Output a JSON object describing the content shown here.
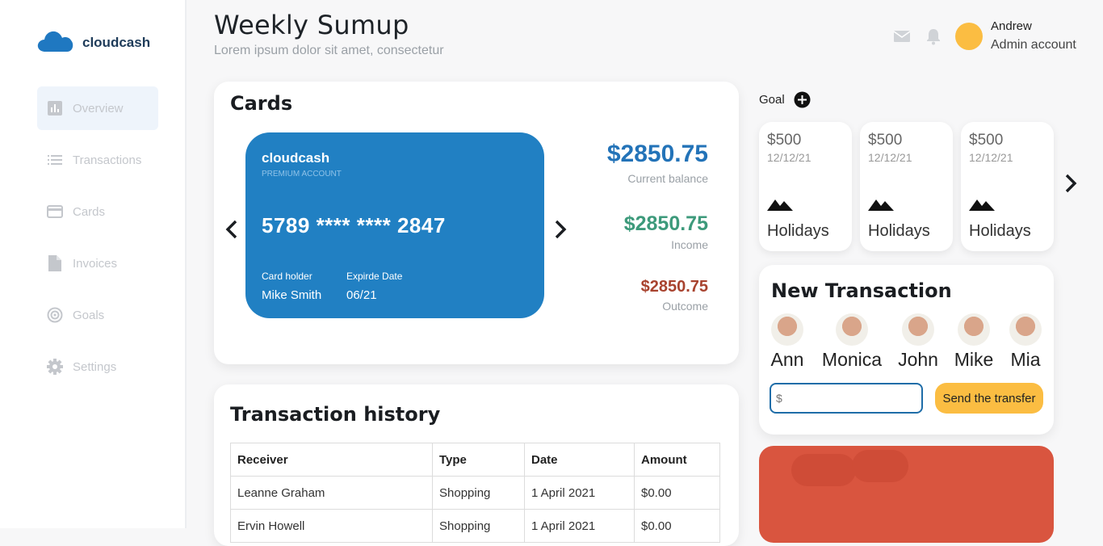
{
  "brand": {
    "name": "cloudcash",
    "color": "#1f78c1"
  },
  "sidebar": {
    "items": [
      {
        "label": "Overview",
        "icon": "bar-chart-icon",
        "active": true
      },
      {
        "label": "Transactions",
        "icon": "list-icon"
      },
      {
        "label": "Cards",
        "icon": "credit-card-icon"
      },
      {
        "label": "Invoices",
        "icon": "document-icon"
      },
      {
        "label": "Goals",
        "icon": "target-icon"
      },
      {
        "label": "Settings",
        "icon": "gear-icon"
      }
    ]
  },
  "header": {
    "title": "Weekly Sumup",
    "subtitle": "Lorem ipsum dolor sit amet, consectetur",
    "user": {
      "name": "Andrew",
      "role": "Admin account"
    }
  },
  "cards": {
    "title": "Cards",
    "card": {
      "brand": "cloudcash",
      "tier": "PREMIUM ACCOUNT",
      "number": "5789 **** **** 2847",
      "holder_label": "Card holder",
      "holder": "Mike Smith",
      "expiry_label": "Expirde Date",
      "expiry": "06/21",
      "color": "#2180c3"
    },
    "balances": [
      {
        "amount": "$2850.75",
        "label": "Current balance",
        "color": "#2373b8"
      },
      {
        "amount": "$2850.75",
        "label": "Income",
        "color": "#3d9a7b"
      },
      {
        "amount": "$2850.75",
        "label": "Outcome",
        "color": "#a8432f"
      }
    ]
  },
  "history": {
    "title": "Transaction history",
    "columns": [
      "Receiver",
      "Type",
      "Date",
      "Amount"
    ],
    "rows": [
      [
        "Leanne Graham",
        "Shopping",
        "1 April 2021",
        "$0.00"
      ],
      [
        "Ervin Howell",
        "Shopping",
        "1 April 2021",
        "$0.00"
      ]
    ]
  },
  "goals": {
    "label": "Goal",
    "items": [
      {
        "amount": "$500",
        "date": "12/12/21",
        "name": "Holidays"
      },
      {
        "amount": "$500",
        "date": "12/12/21",
        "name": "Holidays"
      },
      {
        "amount": "$500",
        "date": "12/12/21",
        "name": "Holidays"
      }
    ]
  },
  "new_transaction": {
    "title": "New Transaction",
    "people": [
      "Ann",
      "Monica",
      "John",
      "Mike",
      "Mia"
    ],
    "amount_placeholder": "$",
    "send_label": "Send the transfer"
  },
  "colors": {
    "accent_yellow": "#fbbd42",
    "promo_red": "#d9553f"
  }
}
